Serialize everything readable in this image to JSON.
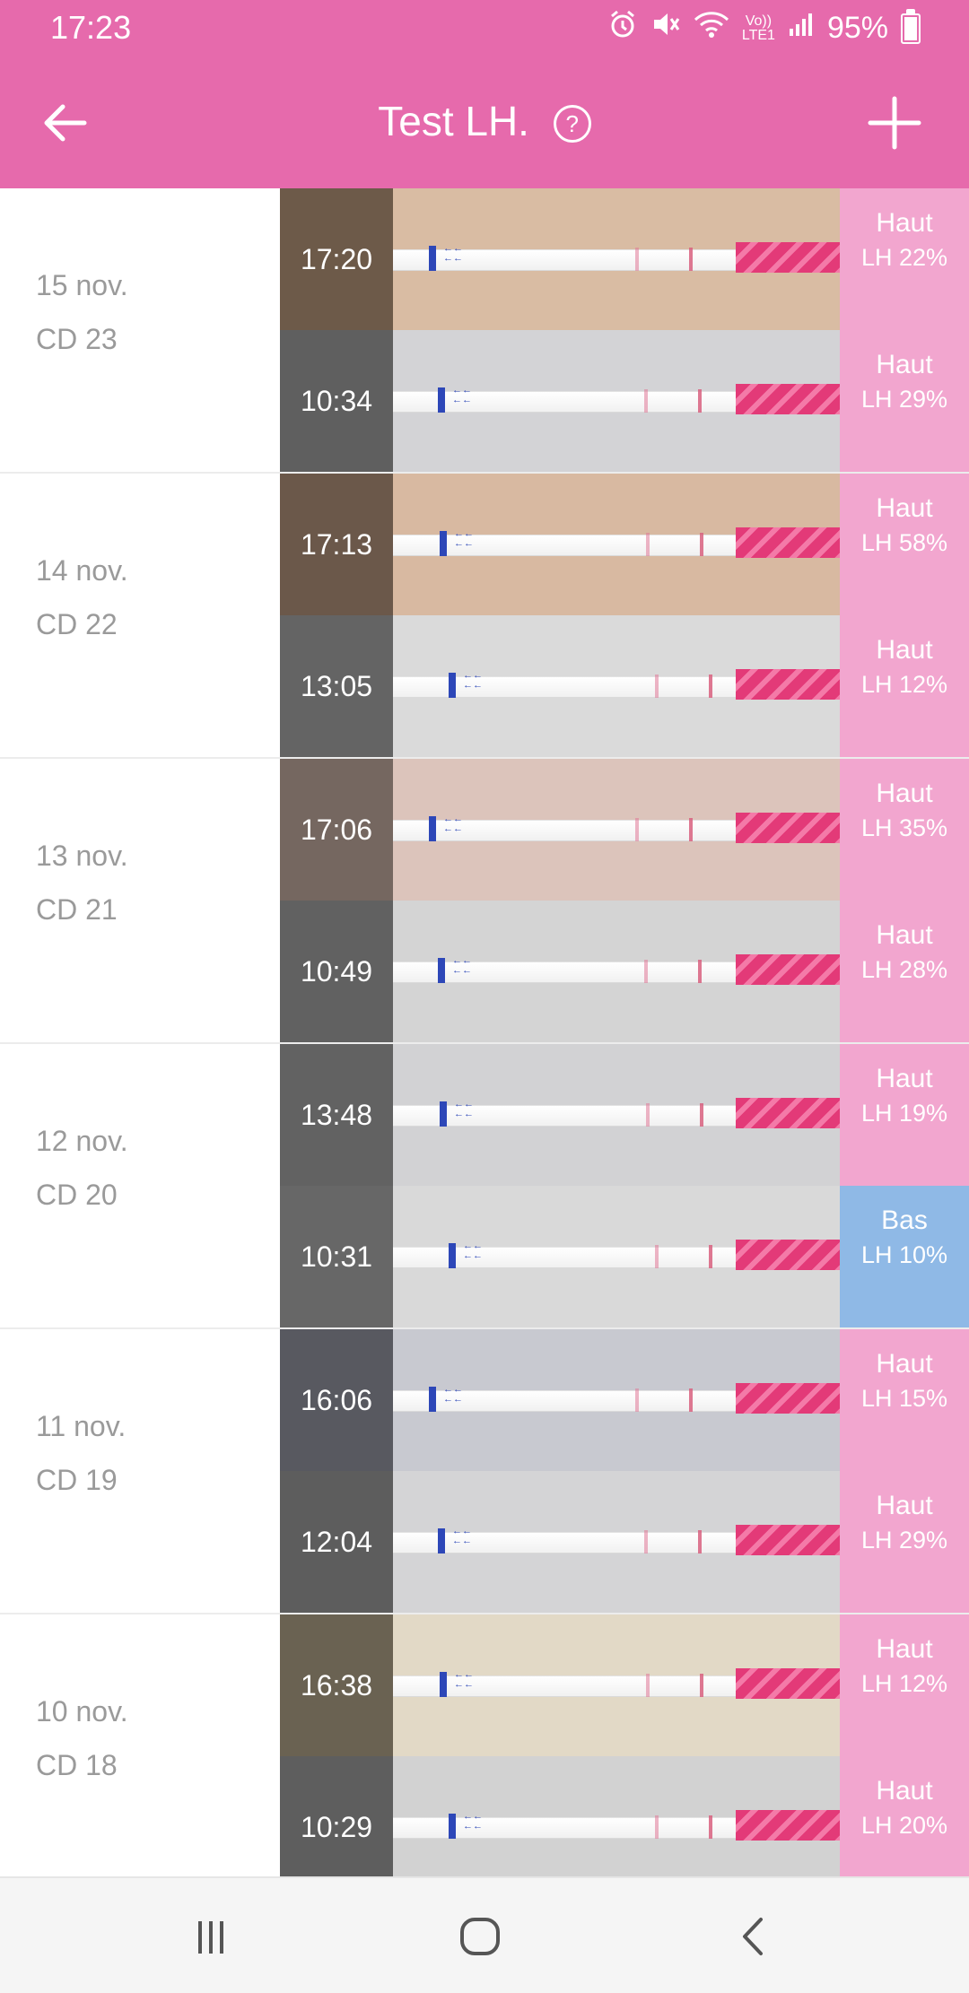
{
  "status_bar": {
    "time": "17:23",
    "battery": "95%",
    "network_label": "Vo))\nLTE1",
    "icons": [
      "alarm-icon",
      "mute-icon",
      "wifi-icon",
      "volte-icon",
      "signal-icon",
      "battery-icon"
    ]
  },
  "app_bar": {
    "title": "Test LH.",
    "help_glyph": "?",
    "back_icon": "arrow-left-icon",
    "add_icon": "plus-icon"
  },
  "colors": {
    "accent": "#e66aac",
    "high": "#f2a6cf",
    "low": "#8fb9e6",
    "label": "#9a9a9a"
  },
  "days": [
    {
      "date": "15 nov.",
      "cycle_day": "CD 23",
      "entries": [
        {
          "time": "17:20",
          "level": "Haut",
          "lh": "LH 22%",
          "kind": "high",
          "time_bg": "#6d5a49",
          "photo_bg": "#d9bca3"
        },
        {
          "time": "10:34",
          "level": "Haut",
          "lh": "LH 29%",
          "kind": "high",
          "time_bg": "#5f5f5f",
          "photo_bg": "#d3d3d6"
        }
      ]
    },
    {
      "date": "14 nov.",
      "cycle_day": "CD 22",
      "entries": [
        {
          "time": "17:13",
          "level": "Haut",
          "lh": "LH 58%",
          "kind": "high",
          "time_bg": "#6b584a",
          "photo_bg": "#d8b9a1"
        },
        {
          "time": "13:05",
          "level": "Haut",
          "lh": "LH 12%",
          "kind": "high",
          "time_bg": "#646464",
          "photo_bg": "#dadada"
        }
      ]
    },
    {
      "date": "13 nov.",
      "cycle_day": "CD 21",
      "entries": [
        {
          "time": "17:06",
          "level": "Haut",
          "lh": "LH 35%",
          "kind": "high",
          "time_bg": "#756760",
          "photo_bg": "#dcc4bb"
        },
        {
          "time": "10:49",
          "level": "Haut",
          "lh": "LH 28%",
          "kind": "high",
          "time_bg": "#616161",
          "photo_bg": "#d4d4d4"
        }
      ]
    },
    {
      "date": "12 nov.",
      "cycle_day": "CD 20",
      "entries": [
        {
          "time": "13:48",
          "level": "Haut",
          "lh": "LH 19%",
          "kind": "high",
          "time_bg": "#626262",
          "photo_bg": "#d2d2d4"
        },
        {
          "time": "10:31",
          "level": "Bas",
          "lh": "LH 10%",
          "kind": "low",
          "time_bg": "#676767",
          "photo_bg": "#d9d9d9"
        }
      ]
    },
    {
      "date": "11 nov.",
      "cycle_day": "CD 19",
      "entries": [
        {
          "time": "16:06",
          "level": "Haut",
          "lh": "LH 15%",
          "kind": "high",
          "time_bg": "#585960",
          "photo_bg": "#c8c9d0"
        },
        {
          "time": "12:04",
          "level": "Haut",
          "lh": "LH 29%",
          "kind": "high",
          "time_bg": "#5d5d5d",
          "photo_bg": "#d4d4d6"
        }
      ]
    },
    {
      "date": "10 nov.",
      "cycle_day": "CD 18",
      "entries": [
        {
          "time": "16:38",
          "level": "Haut",
          "lh": "LH 12%",
          "kind": "high",
          "time_bg": "#6a6252",
          "photo_bg": "#e2d9c6"
        },
        {
          "time": "10:29",
          "level": "Haut",
          "lh": "LH 20%",
          "kind": "high",
          "time_bg": "#5e5e5e",
          "photo_bg": "#d2d2d2"
        }
      ]
    }
  ],
  "nav_bar": {
    "icons": [
      "recent-apps-icon",
      "home-icon",
      "back-icon"
    ]
  }
}
